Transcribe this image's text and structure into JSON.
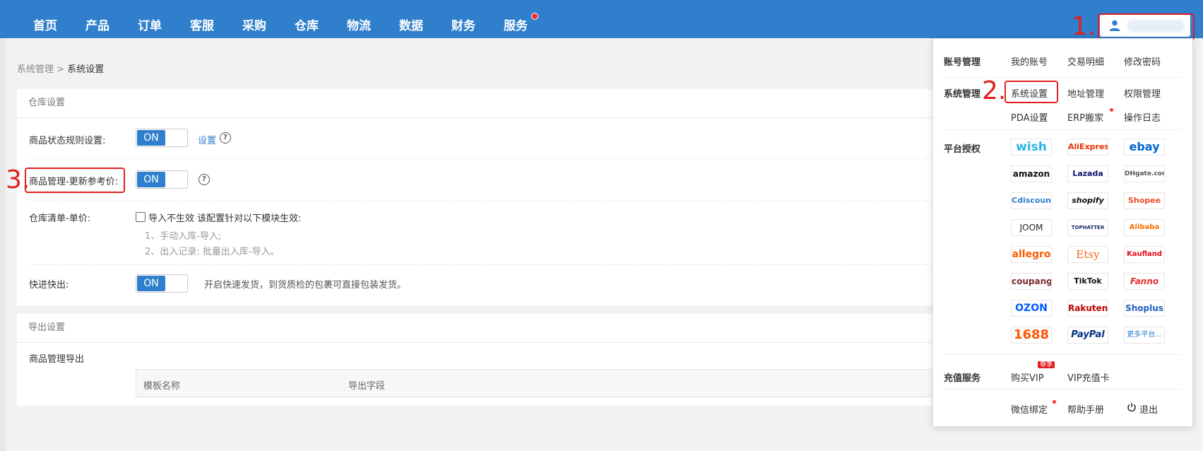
{
  "nav": {
    "items": [
      "首页",
      "产品",
      "订单",
      "客服",
      "采购",
      "仓库",
      "物流",
      "数据",
      "财务",
      "服务"
    ],
    "accent_color": "#2f7fcc"
  },
  "annotations": {
    "step1": "1.",
    "step2": "2.",
    "step3": "3."
  },
  "breadcrumb": {
    "parent": "系统管理",
    "sep": ">",
    "current": "系统设置"
  },
  "warehouse": {
    "title": "仓库设置",
    "status_rule_label": "商品状态规则设置:",
    "status_rule_toggle": "ON",
    "status_rule_link": "设置",
    "ref_price_label": "商品管理-更新参考价:",
    "ref_price_toggle": "ON",
    "list_price_label": "仓库清单-单价:",
    "list_price_checkbox": "导入不生效 该配置针对以下模块生效:",
    "list_price_note1": "1、手动入库-导入;",
    "list_price_note2": "2、出入记录: 批量出入库-导入。",
    "fast_label": "快进快出:",
    "fast_toggle": "ON",
    "fast_desc": "开启快速发货，到货质检的包裹可直接包装发货。"
  },
  "export": {
    "title": "导出设置",
    "product_export_label": "商品管理导出",
    "columns": [
      "模板名称",
      "导出字段"
    ]
  },
  "dropdown": {
    "account": {
      "title": "账号管理",
      "items": [
        "我的账号",
        "交易明细",
        "修改密码"
      ]
    },
    "system": {
      "title": "系统管理",
      "items": [
        "系统设置",
        "地址管理",
        "权限管理",
        "PDA设置",
        "ERP搬家",
        "操作日志"
      ]
    },
    "platform": {
      "title": "平台授权",
      "logos": [
        "wish",
        "AliExpress",
        "ebay",
        "amazon",
        "Lazada",
        "DHgate.com",
        "Cdiscount",
        "shopify",
        "Shopee",
        "JOOM",
        "TOPHATTER",
        "Alibaba",
        "allegro",
        "Etsy",
        "Kaufland",
        "coupang",
        "TikTok",
        "Fanno",
        "OZON",
        "Rakuten",
        "Shoplus",
        "1688",
        "PayPal",
        "更多平台..."
      ]
    },
    "recharge": {
      "title": "充值服务",
      "items": [
        "购买VIP",
        "VIP充值卡"
      ],
      "badge": "尊享"
    },
    "misc": {
      "items": [
        "微信绑定",
        "帮助手册",
        "退出"
      ]
    }
  }
}
